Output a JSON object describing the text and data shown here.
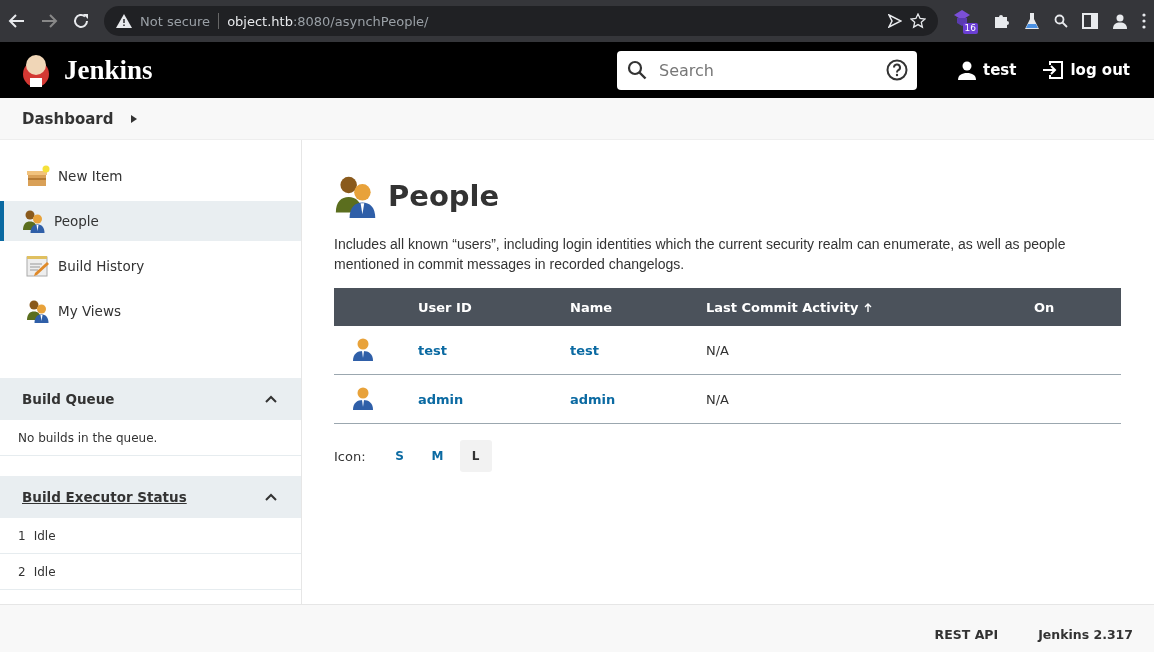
{
  "browser": {
    "security": "Not secure",
    "url_host": "object.htb",
    "url_path": ":8080/asynchPeople/",
    "extension_badge": "16"
  },
  "header": {
    "title": "Jenkins",
    "search": {
      "placeholder": "Search"
    },
    "user": "test",
    "logout": "log out"
  },
  "breadcrumb": [
    "Dashboard"
  ],
  "sidebar": {
    "tasks": [
      {
        "label": "New Item",
        "kind": "box",
        "selected": false
      },
      {
        "label": "People",
        "kind": "people",
        "selected": true
      },
      {
        "label": "Build History",
        "kind": "notepad",
        "selected": false
      },
      {
        "label": "My Views",
        "kind": "people",
        "selected": false
      }
    ],
    "build_queue": {
      "title": "Build Queue",
      "expanded": true,
      "message": "No builds in the queue."
    },
    "executors": {
      "title": "Build Executor Status",
      "expanded": true,
      "rows": [
        {
          "number": "1",
          "status": "Idle"
        },
        {
          "number": "2",
          "status": "Idle"
        }
      ]
    }
  },
  "main": {
    "title": "People",
    "description": "Includes all known “users”, including login identities which the current security realm can enumerate, as well as people mentioned in commit messages in recorded changelogs.",
    "table": {
      "columns": [
        {
          "label": "User ID",
          "sorted": false
        },
        {
          "label": "Name",
          "sorted": false
        },
        {
          "label": "Last Commit Activity",
          "sorted": true
        },
        {
          "label": "On",
          "sorted": false
        }
      ],
      "rows": [
        {
          "user_id": "test",
          "name": "test",
          "last_commit": "N/A"
        },
        {
          "user_id": "admin",
          "name": "admin",
          "last_commit": "N/A"
        }
      ]
    },
    "icon_label": "Icon:",
    "icon_sizes": [
      {
        "label": "S",
        "selected": false
      },
      {
        "label": "M",
        "selected": false
      },
      {
        "label": "L",
        "selected": true
      }
    ]
  },
  "footer": [
    "REST API",
    "Jenkins 2.317"
  ]
}
